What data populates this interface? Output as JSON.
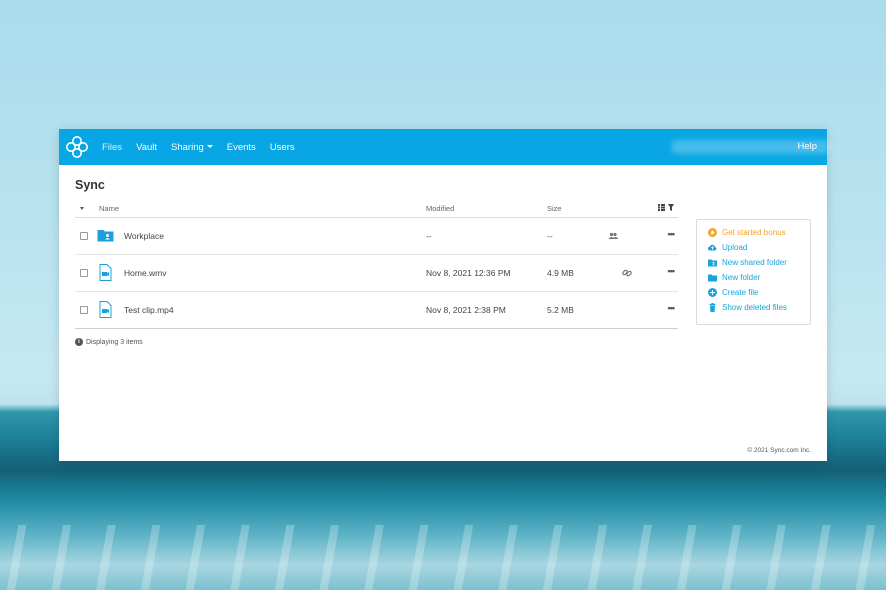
{
  "nav": {
    "items": [
      {
        "label": "Files",
        "active": true
      },
      {
        "label": "Vault"
      },
      {
        "label": "Sharing",
        "dropdown": true
      },
      {
        "label": "Events"
      },
      {
        "label": "Users"
      }
    ],
    "help": "Help"
  },
  "page": {
    "title": "Sync"
  },
  "table": {
    "headers": {
      "name": "Name",
      "modified": "Modified",
      "size": "Size"
    },
    "rows": [
      {
        "name": "Workplace",
        "modified": "--",
        "size": "--",
        "type": "shared-folder-icon",
        "extra": "people-icon"
      },
      {
        "name": "Home.wmv",
        "modified": "Nov 8, 2021 12:36 PM",
        "size": "4.9 MB",
        "type": "video-file-icon",
        "extra": "link-icon"
      },
      {
        "name": "Test clip.mp4",
        "modified": "Nov 8, 2021 2:38 PM",
        "size": "5.2 MB",
        "type": "video-file-icon"
      }
    ],
    "count_text": "Displaying 3 items"
  },
  "actions": {
    "bonus": "Get started bonus",
    "upload": "Upload",
    "new_shared_folder": "New shared folder",
    "new_folder": "New folder",
    "create_file": "Create file",
    "show_deleted": "Show deleted files"
  },
  "footer": {
    "copyright": "© 2021 Sync.com Inc."
  },
  "colors": {
    "brand": "#08a6e4",
    "accent": "#1aa3dc",
    "bonus": "#f0a524"
  }
}
